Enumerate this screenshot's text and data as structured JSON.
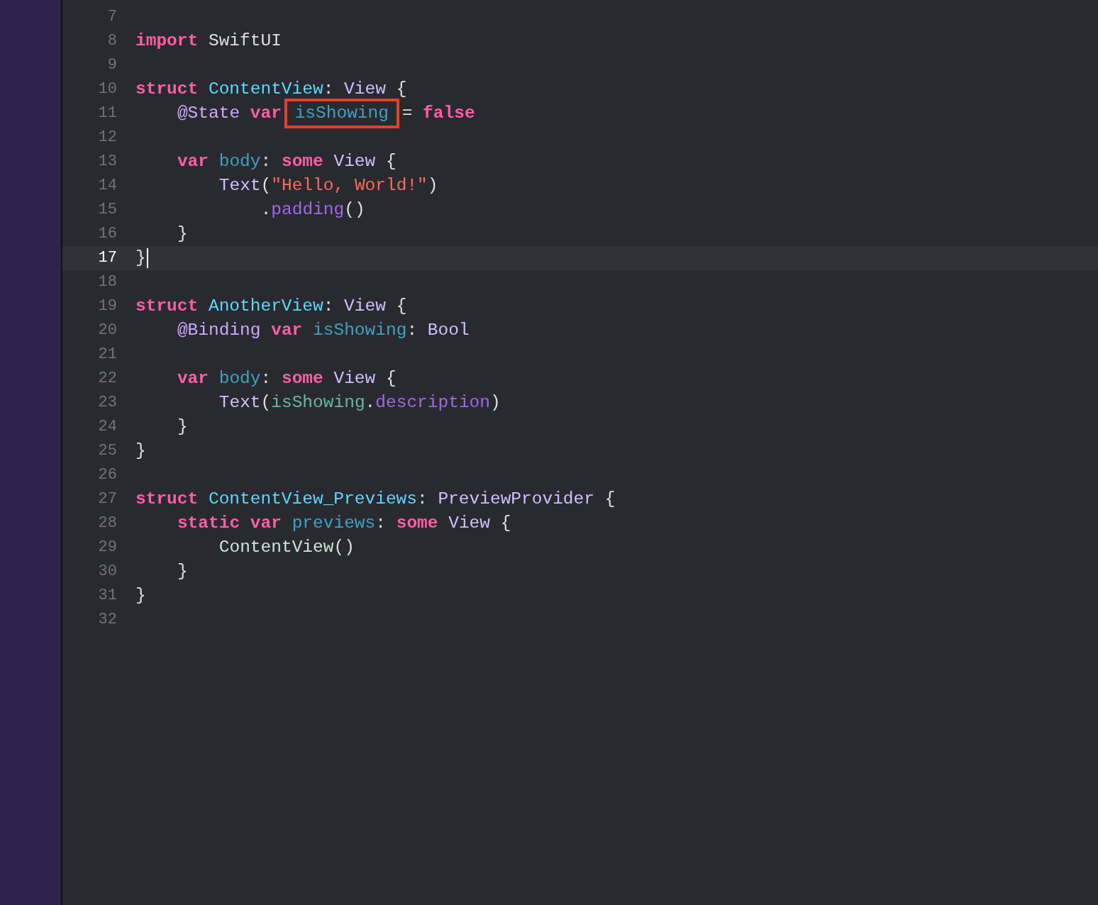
{
  "editor": {
    "lines": [
      {
        "number": "7",
        "current": false
      },
      {
        "number": "8",
        "current": false,
        "tokens": [
          {
            "kind": "keyword",
            "text": "import"
          },
          {
            "kind": "plain",
            "text": "SwiftUI",
            "space_before": true
          }
        ]
      },
      {
        "number": "9",
        "current": false
      },
      {
        "number": "10",
        "current": false,
        "tokens": [
          {
            "kind": "keyword",
            "text": "struct"
          },
          {
            "kind": "decl",
            "text": "ContentView",
            "space_before": true
          },
          {
            "kind": "plain",
            "text": ":"
          },
          {
            "kind": "type",
            "text": "View",
            "space_before": true
          },
          {
            "kind": "open",
            "text": "{",
            "space_before": true
          }
        ]
      },
      {
        "number": "11",
        "current": false,
        "tokens": [
          {
            "kind": "attribute",
            "text": "@State"
          },
          {
            "kind": "keyword",
            "text": "var",
            "space_before": true
          },
          {
            "kind": "property",
            "text": "isShowing",
            "space_before": true,
            "boxed": true
          },
          {
            "kind": "plain",
            "text": "=",
            "space_before": true
          },
          {
            "kind": "keyword",
            "text": "false",
            "space_before": true
          }
        ]
      },
      {
        "number": "12",
        "current": false
      },
      {
        "number": "13",
        "current": false,
        "tokens": [
          {
            "kind": "keyword",
            "text": "var"
          },
          {
            "kind": "property",
            "text": "body",
            "space_before": true
          },
          {
            "kind": "plain",
            "text": ":"
          },
          {
            "kind": "keyword",
            "text": "some",
            "space_before": true
          },
          {
            "kind": "type",
            "text": "View",
            "space_before": true
          },
          {
            "kind": "open",
            "text": "{",
            "space_before": true
          }
        ]
      },
      {
        "number": "14",
        "current": false,
        "tokens": [
          {
            "kind": "type",
            "text": "Text"
          },
          {
            "kind": "plain",
            "text": "("
          },
          {
            "kind": "string",
            "text": "\"Hello, World!\""
          },
          {
            "kind": "plain",
            "text": ")"
          }
        ]
      },
      {
        "number": "15",
        "current": false,
        "tokens": [
          {
            "kind": "dot",
            "text": "."
          },
          {
            "kind": "method",
            "text": "padding"
          },
          {
            "kind": "plain",
            "text": "()"
          }
        ]
      },
      {
        "number": "16",
        "current": false,
        "tokens": [
          {
            "kind": "close",
            "text": "}"
          }
        ]
      },
      {
        "number": "17",
        "current": true,
        "tokens": [
          {
            "kind": "close",
            "text": "}"
          }
        ]
      },
      {
        "number": "18",
        "current": false
      },
      {
        "number": "19",
        "current": false,
        "tokens": [
          {
            "kind": "keyword",
            "text": "struct"
          },
          {
            "kind": "decl",
            "text": "AnotherView",
            "space_before": true
          },
          {
            "kind": "plain",
            "text": ":"
          },
          {
            "kind": "type",
            "text": "View",
            "space_before": true
          },
          {
            "kind": "open",
            "text": "{",
            "space_before": true
          }
        ]
      },
      {
        "number": "20",
        "current": false,
        "tokens": [
          {
            "kind": "attribute",
            "text": "@Binding"
          },
          {
            "kind": "keyword",
            "text": "var",
            "space_before": true
          },
          {
            "kind": "property",
            "text": "isShowing",
            "space_before": true
          },
          {
            "kind": "plain",
            "text": ":"
          },
          {
            "kind": "type",
            "text": "Bool",
            "space_before": true
          }
        ]
      },
      {
        "number": "21",
        "current": false
      },
      {
        "number": "22",
        "current": false,
        "tokens": [
          {
            "kind": "keyword",
            "text": "var"
          },
          {
            "kind": "property",
            "text": "body",
            "space_before": true
          },
          {
            "kind": "plain",
            "text": ":"
          },
          {
            "kind": "keyword",
            "text": "some",
            "space_before": true
          },
          {
            "kind": "type",
            "text": "View",
            "space_before": true
          },
          {
            "kind": "open",
            "text": "{",
            "space_before": true
          }
        ]
      },
      {
        "number": "23",
        "current": false,
        "tokens": [
          {
            "kind": "type",
            "text": "Text"
          },
          {
            "kind": "plain",
            "text": "("
          },
          {
            "kind": "reference",
            "text": "isShowing"
          },
          {
            "kind": "plain",
            "text": "."
          },
          {
            "kind": "method",
            "text": "description"
          },
          {
            "kind": "plain",
            "text": ")"
          }
        ]
      },
      {
        "number": "24",
        "current": false,
        "tokens": [
          {
            "kind": "close",
            "text": "}"
          }
        ]
      },
      {
        "number": "25",
        "current": false,
        "tokens": [
          {
            "kind": "close",
            "text": "}"
          }
        ]
      },
      {
        "number": "26",
        "current": false
      },
      {
        "number": "27",
        "current": false,
        "tokens": [
          {
            "kind": "keyword",
            "text": "struct"
          },
          {
            "kind": "decl",
            "text": "ContentView_Previews",
            "space_before": true
          },
          {
            "kind": "plain",
            "text": ":"
          },
          {
            "kind": "type",
            "text": "PreviewProvider",
            "space_before": true
          },
          {
            "kind": "open",
            "text": "{",
            "space_before": true
          }
        ]
      },
      {
        "number": "28",
        "current": false,
        "tokens": [
          {
            "kind": "keyword",
            "text": "static"
          },
          {
            "kind": "keyword",
            "text": "var",
            "space_before": true
          },
          {
            "kind": "property",
            "text": "previews",
            "space_before": true
          },
          {
            "kind": "plain",
            "text": ":"
          },
          {
            "kind": "keyword",
            "text": "some",
            "space_before": true
          },
          {
            "kind": "type",
            "text": "View",
            "space_before": true
          },
          {
            "kind": "open",
            "text": "{",
            "space_before": true
          }
        ]
      },
      {
        "number": "29",
        "current": false,
        "tokens": [
          {
            "kind": "project",
            "text": "ContentView"
          },
          {
            "kind": "plain",
            "text": "()"
          }
        ]
      },
      {
        "number": "30",
        "current": false,
        "tokens": [
          {
            "kind": "close",
            "text": "}"
          }
        ]
      },
      {
        "number": "31",
        "current": false,
        "tokens": [
          {
            "kind": "close",
            "text": "}"
          }
        ]
      },
      {
        "number": "32",
        "current": false
      }
    ]
  }
}
